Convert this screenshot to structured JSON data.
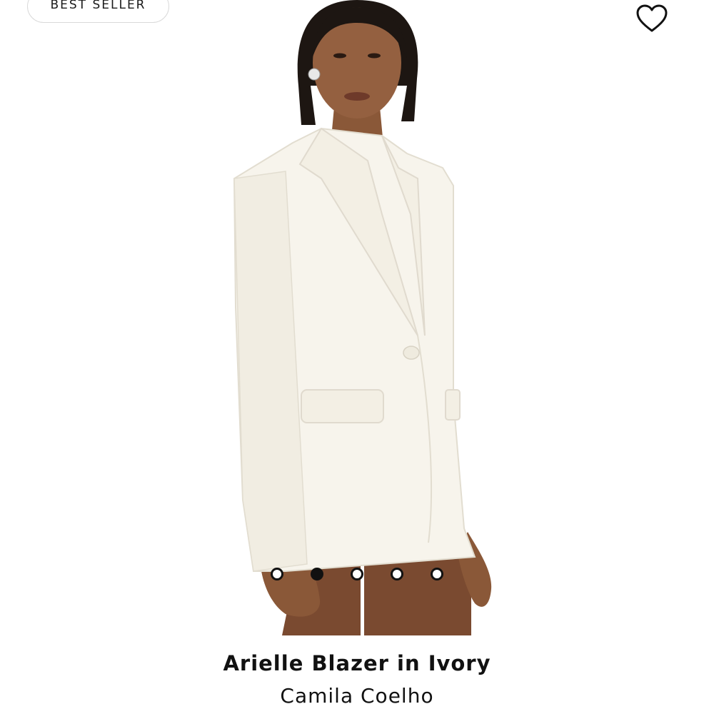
{
  "badge": {
    "label": "BEST SELLER"
  },
  "icons": {
    "wishlist": "heart-outline-icon"
  },
  "product": {
    "title": "Arielle Blazer in Ivory",
    "brand": "Camila Coelho",
    "image_description_color": "#f7f4ec"
  },
  "carousel": {
    "total": 5,
    "active_index": 1
  },
  "colors": {
    "text": "#111111",
    "badge_border": "#d9d9d9",
    "background": "#ffffff"
  }
}
